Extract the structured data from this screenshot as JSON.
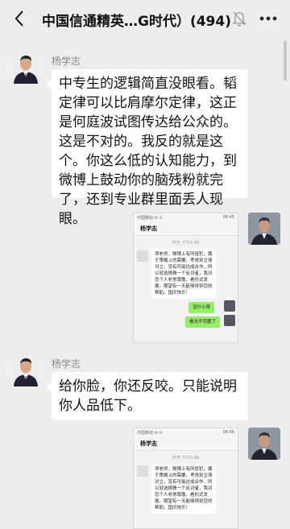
{
  "header": {
    "title": "中国信通精英…G时代）(494)"
  },
  "messages": [
    {
      "sender": "杨学志",
      "text": "中专生的逻辑简直没眼看。韬定律可以比肩摩尔定律，这正是何庭波试图传达给公众的。这是不对的。我反的就是这个。你这么低的认知能力，到微博上鼓动你的脑残粉就完了，还到专业群里面丢人现眼。"
    },
    {
      "sender": "杨学志",
      "text": "给你脸，你还反咬。只能说明你人品低下。"
    }
  ],
  "screenshot1": {
    "status_left": "中国移动 ✉ ⊙",
    "status_right": "08:45",
    "chat_title": "杨学志",
    "time": "昨天 下午5:48",
    "incoming": "项老师，微博上有所冒犯，属于策略上的需要。考虑到立场对立，没有可能达成合作，所以就选择做一个反对者，我对您个人非常尊敬，看形式发展，期望有一天能够得到您的帮助。国庆快乐！",
    "out1": "没什么呀",
    "out2": "看法不同罢了"
  },
  "screenshot2": {
    "status_left": "中国移动 ✉ ⊙",
    "status_right": "08:46",
    "chat_title": "杨学志",
    "time": "昨天 下午5:48",
    "incoming": "项老师，微博上有所冒犯，属于策略上的需要。考虑到立场对立，没有可能达成合作，所以就选择做一个反对者，我对您个人非常尊敬，看形式发展，期望有一天能够得到您的帮助。国庆快乐！"
  }
}
